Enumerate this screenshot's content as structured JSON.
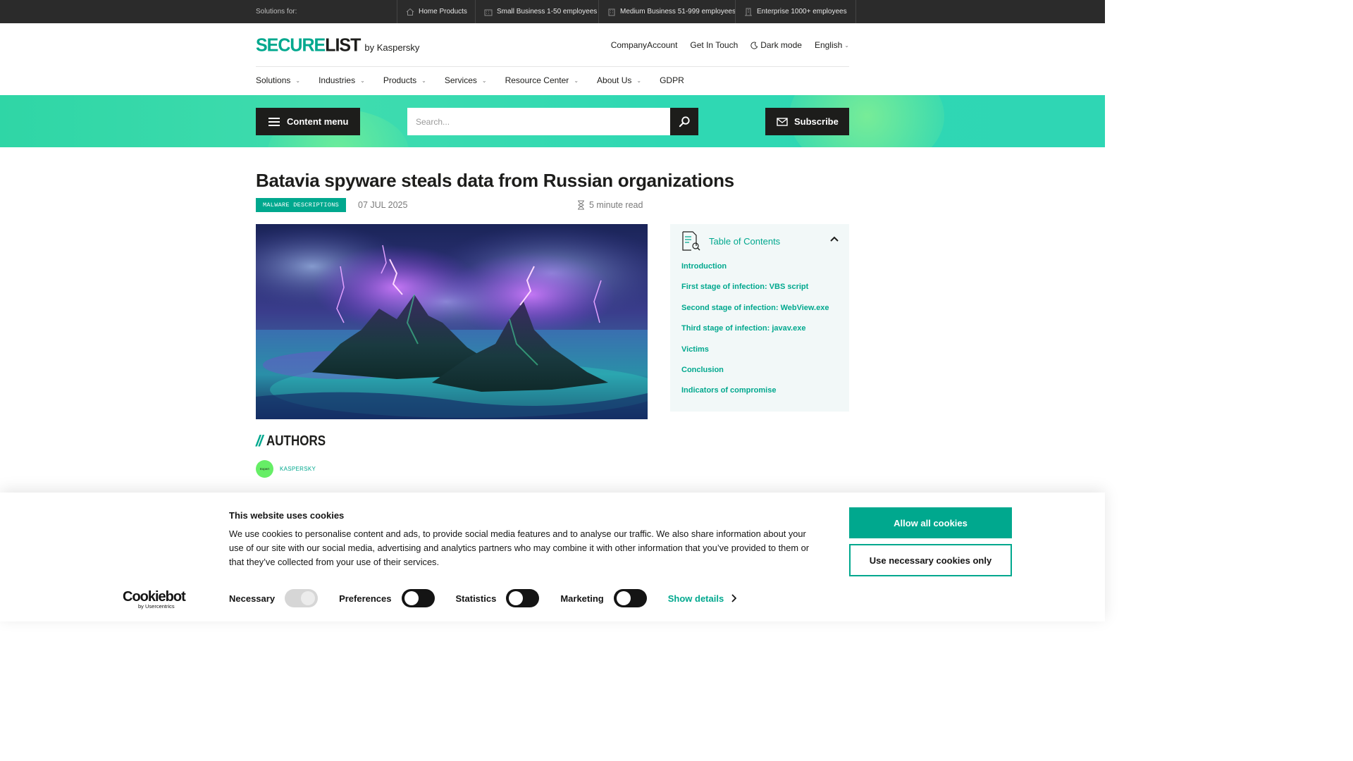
{
  "topbar": {
    "label": "Solutions for:",
    "items": [
      {
        "label": "Home Products",
        "icon": "home-icon"
      },
      {
        "label": "Small Business 1-50 employees",
        "icon": "building-small-icon"
      },
      {
        "label": "Medium Business 51-999 employees",
        "icon": "building-medium-icon"
      },
      {
        "label": "Enterprise 1000+ employees",
        "icon": "building-large-icon"
      }
    ]
  },
  "header": {
    "logo_part1": "SECURE",
    "logo_part2": "LIST",
    "logo_by": "by Kaspersky",
    "links": {
      "company_account": "CompanyAccount",
      "get_in_touch": "Get In Touch",
      "dark_mode": "Dark mode",
      "language": "English"
    }
  },
  "nav": {
    "items": [
      "Solutions",
      "Industries",
      "Products",
      "Services",
      "Resource Center",
      "About Us",
      "GDPR"
    ]
  },
  "band": {
    "content_menu": "Content menu",
    "search_placeholder": "Search...",
    "subscribe": "Subscribe"
  },
  "article": {
    "title": "Batavia spyware steals data from Russian organizations",
    "tag": "MALWARE DESCRIPTIONS",
    "date": "07 JUL 2025",
    "read_time": "5 minute read",
    "authors_heading": "AUTHORS",
    "authors_slashes": "//",
    "author_avatar_text": "Expert",
    "author_name": "KASPERSKY"
  },
  "toc": {
    "title": "Table of Contents",
    "items": [
      "Introduction",
      "First stage of infection: VBS script",
      "Second stage of infection: WebView.exe",
      "Third stage of infection: javav.exe",
      "Victims",
      "Conclusion",
      "Indicators of compromise"
    ]
  },
  "cookie": {
    "logo_word": "Cookiebot",
    "logo_sub": "by Usercentrics",
    "title": "This website uses cookies",
    "text": "We use cookies to personalise content and ads, to provide social media features and to analyse our traffic. We also share information about your use of our site with our social media, advertising and analytics partners who may combine it with other information that you’ve provided to them or that they’ve collected from your use of their services.",
    "toggles": {
      "necessary": "Necessary",
      "preferences": "Preferences",
      "statistics": "Statistics",
      "marketing": "Marketing"
    },
    "show_details": "Show details",
    "allow_all": "Allow all cookies",
    "necessary_only": "Use necessary cookies only"
  },
  "colors": {
    "accent": "#00a88e",
    "dark": "#1d1d1b",
    "band": "#2fd6b4"
  }
}
